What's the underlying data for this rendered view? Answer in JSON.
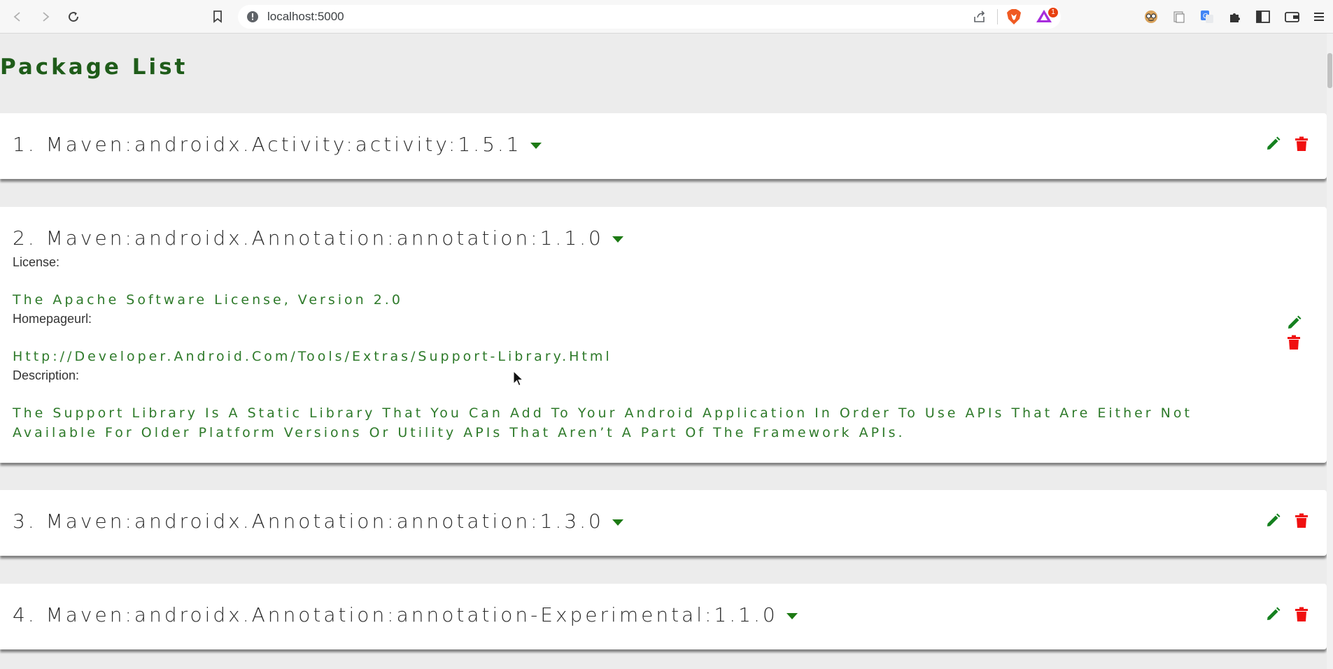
{
  "browser": {
    "url": "localhost:5000",
    "rewards_badge": "1"
  },
  "page": {
    "title": "Package List"
  },
  "packages": [
    {
      "title": "1. Maven:androidx.Activity:activity:1.5.1"
    },
    {
      "title": "2. Maven:androidx.Annotation:annotation:1.1.0",
      "license_label": "License:",
      "license": "The Apache Software License, Version 2.0",
      "homepage_label": "Homepageurl:",
      "homepage": "Http://Developer.Android.Com/Tools/Extras/Support-Library.Html",
      "description_label": "Description:",
      "description": "The Support Library Is A Static Library That You Can Add To Your Android Application In Order To Use APIs That Are Either Not Available For Older Platform Versions Or Utility APIs That Aren’t A Part Of The Framework APIs."
    },
    {
      "title": "3. Maven:androidx.Annotation:annotation:1.3.0"
    },
    {
      "title": "4. Maven:androidx.Annotation:annotation-Experimental:1.1.0"
    }
  ],
  "colors": {
    "title_green": "#1f5c1a",
    "edit_icon": "#14801e",
    "delete_icon": "#f01010",
    "value_green": "#2e7a2a"
  },
  "icons": [
    "back-icon",
    "forward-icon",
    "reload-icon",
    "bookmark-icon",
    "info-icon",
    "share-icon",
    "brave-shield-icon",
    "brave-rewards-icon",
    "extension-icon",
    "translate-icon",
    "puzzle-icon",
    "sidebar-icon",
    "wallet-icon",
    "menu-icon",
    "edit-icon",
    "delete-icon",
    "caret-down-icon"
  ]
}
